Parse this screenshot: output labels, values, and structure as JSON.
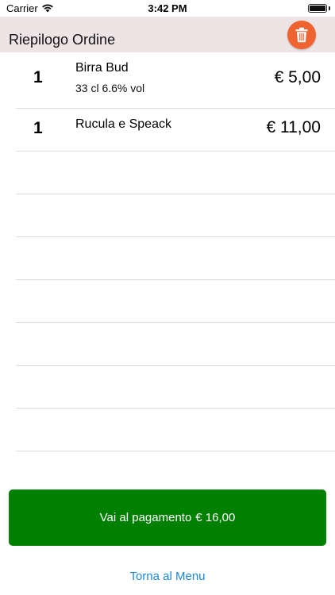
{
  "status_bar": {
    "carrier": "Carrier",
    "time": "3:42 PM",
    "wifi_icon": "wifi-icon",
    "battery_icon": "battery-full-icon"
  },
  "header": {
    "title": "Riepilogo Ordine",
    "trash_icon": "trash-icon",
    "trash_color": "#ef6330",
    "background": "#eee4e6"
  },
  "order": {
    "items": [
      {
        "qty": "1",
        "name": "Birra Bud",
        "description": "33 cl 6.6% vol",
        "price": "€ 5,00"
      },
      {
        "qty": "1",
        "name": "Rucula e Speack",
        "description": "",
        "price": "€ 11,00"
      }
    ]
  },
  "footer": {
    "pay_label": "Vai al pagamento",
    "pay_total": "€ 16,00",
    "pay_color": "#008000",
    "menu_link": "Torna al Menu",
    "link_color": "#1d87d9"
  }
}
